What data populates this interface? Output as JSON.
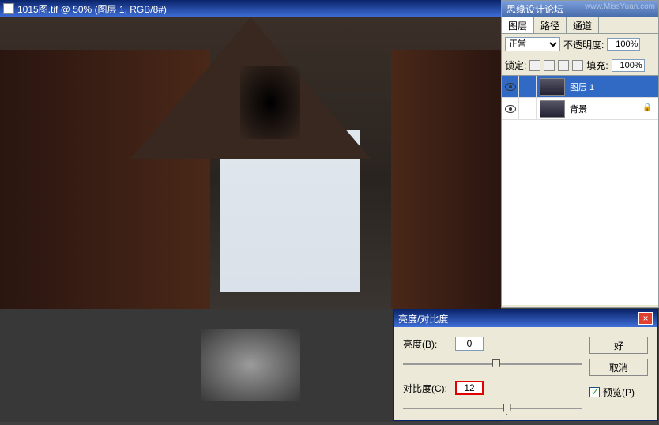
{
  "document": {
    "title": "1015图.tif @ 50% (图层 1, RGB/8#)"
  },
  "layers_panel": {
    "header": "思缘设计论坛",
    "watermark": "www.MissYuan.com",
    "tabs": {
      "layers": "图层",
      "paths": "路径",
      "channels": "通道"
    },
    "blend_mode": "正常",
    "opacity_label": "不透明度:",
    "opacity_value": "100%",
    "lock_label": "锁定:",
    "fill_label": "填充:",
    "fill_value": "100%",
    "layers": [
      {
        "name": "图层 1",
        "selected": true,
        "locked": false
      },
      {
        "name": "背景",
        "selected": false,
        "locked": true
      }
    ]
  },
  "dialog": {
    "title": "亮度/对比度",
    "brightness_label": "亮度(B):",
    "brightness_value": "0",
    "contrast_label": "对比度(C):",
    "contrast_value": "12",
    "ok": "好",
    "cancel": "取消",
    "preview": "预览(P)"
  }
}
